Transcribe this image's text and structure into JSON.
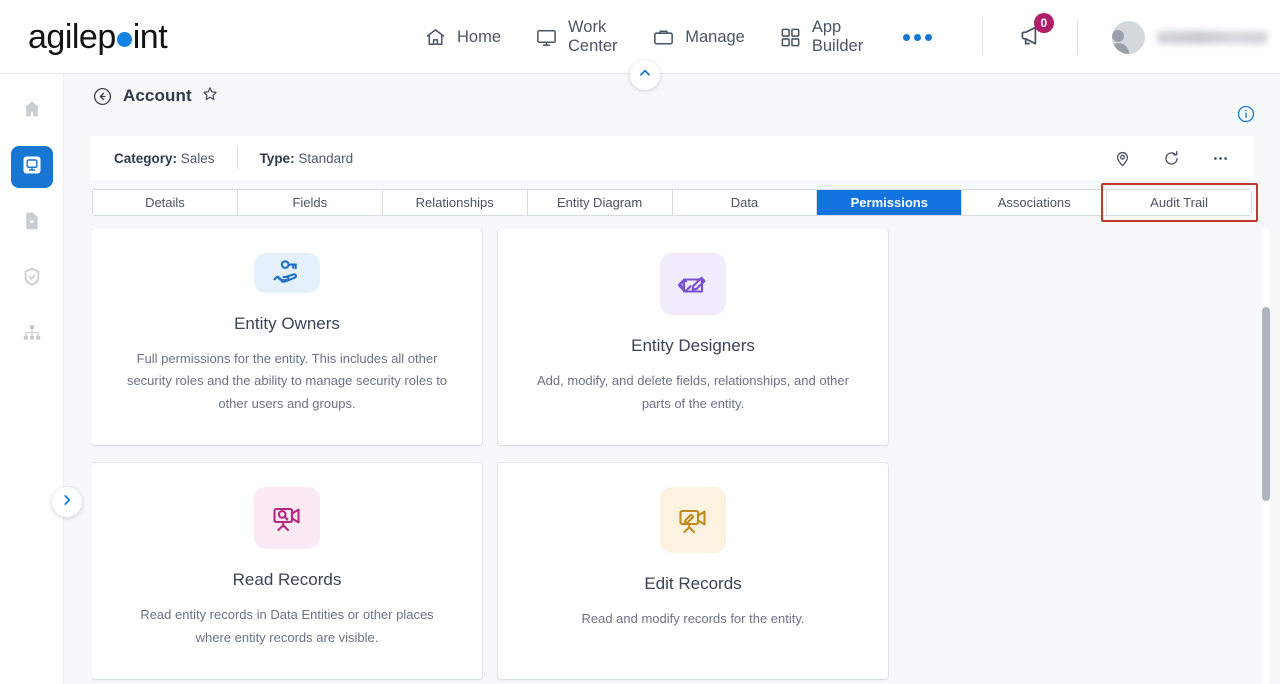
{
  "brand": {
    "name_part1": "agilep",
    "name_part2": "int"
  },
  "topnav": {
    "items": [
      {
        "label": "Home",
        "icon": "home-icon"
      },
      {
        "label": "Work Center",
        "icon": "monitor-icon"
      },
      {
        "label": "Manage",
        "icon": "briefcase-icon"
      },
      {
        "label": "App Builder",
        "icon": "grid-icon"
      }
    ],
    "more_label": "",
    "notifications_count": "0",
    "user_name": ""
  },
  "rail": {
    "items": [
      {
        "name": "home",
        "icon": "home-icon",
        "active": false
      },
      {
        "name": "app-builder",
        "icon": "app-window-icon",
        "active": true
      },
      {
        "name": "documents",
        "icon": "document-check-icon",
        "active": false
      },
      {
        "name": "security",
        "icon": "shield-check-icon",
        "active": false
      },
      {
        "name": "hierarchy",
        "icon": "sitemap-icon",
        "active": false
      }
    ],
    "expand_icon": "chevron-right-icon"
  },
  "page": {
    "title": "Account",
    "back_icon": "back-arrow-icon",
    "star_icon": "star-icon",
    "info_icon": "info-icon",
    "collapse_icon": "chevron-up-icon"
  },
  "meta": {
    "category_label": "Category:",
    "category_value": "Sales",
    "type_label": "Type:",
    "type_value": "Standard",
    "tools": [
      {
        "name": "location-pin-icon"
      },
      {
        "name": "refresh-icon"
      },
      {
        "name": "ellipsis-icon"
      }
    ]
  },
  "tabs": [
    {
      "label": "Details",
      "active": false,
      "highlighted": false
    },
    {
      "label": "Fields",
      "active": false,
      "highlighted": false
    },
    {
      "label": "Relationships",
      "active": false,
      "highlighted": false
    },
    {
      "label": "Entity Diagram",
      "active": false,
      "highlighted": false
    },
    {
      "label": "Data",
      "active": false,
      "highlighted": false
    },
    {
      "label": "Permissions",
      "active": true,
      "highlighted": false
    },
    {
      "label": "Associations",
      "active": false,
      "highlighted": false
    },
    {
      "label": "Audit Trail",
      "active": false,
      "highlighted": true
    }
  ],
  "cards": [
    {
      "title": "Entity Owners",
      "description": "Full permissions for the entity. This includes all other security roles and the ability to manage security roles to other users and groups.",
      "icon": "hand-key-icon",
      "icon_color": "#1f6fc4",
      "icon_bg": "#e4f0fb"
    },
    {
      "title": "Entity Designers",
      "description": "Add, modify, and delete fields, relationships, and other parts of the entity.",
      "icon": "pencil-ruler-icon",
      "icon_color": "#7a4fd1",
      "icon_bg": "#f1ecfb"
    },
    {
      "title": "Read Records",
      "description": "Read entity records in Data Entities or other places where entity records are visible.",
      "icon": "camera-search-icon",
      "icon_color": "#b5277f",
      "icon_bg": "#fbe9f4"
    },
    {
      "title": "Edit Records",
      "description": "Read and modify records for the entity.",
      "icon": "camera-edit-icon",
      "icon_color": "#c08a1c",
      "icon_bg": "#fbf3e0"
    }
  ],
  "colors": {
    "accent_blue": "#1273de",
    "logo_blue": "#1581e0",
    "badge_magenta": "#b01d68",
    "highlight_red": "#c0392b"
  }
}
